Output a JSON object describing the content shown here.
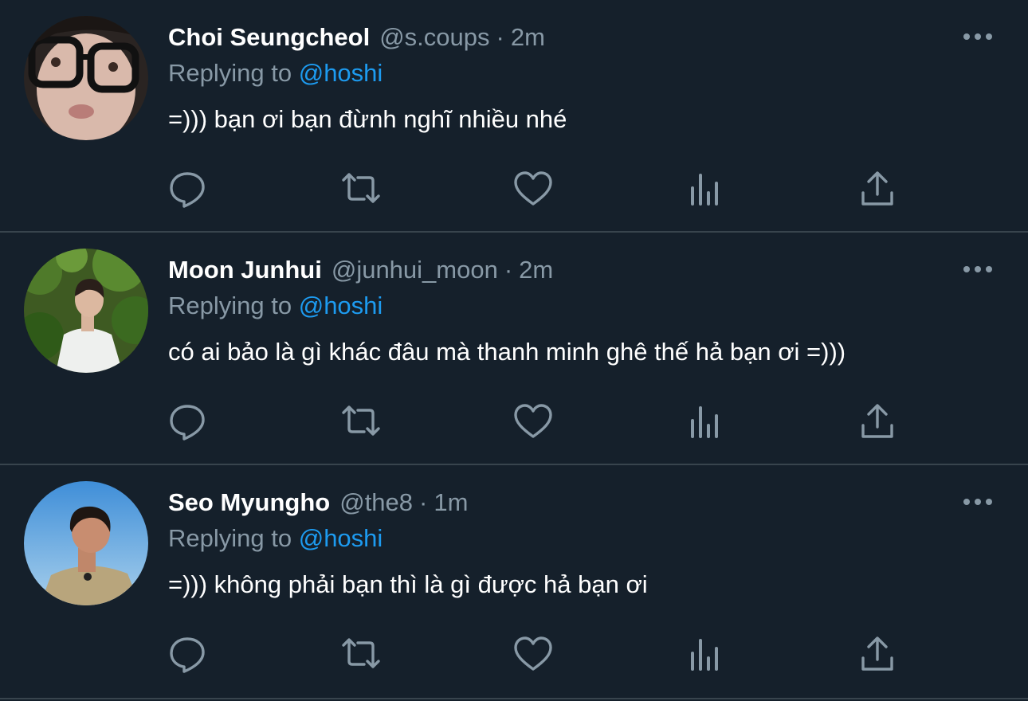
{
  "colors": {
    "background": "#15202b",
    "divider": "#38444d",
    "secondary_text": "#8899a6",
    "mention": "#1d9bf0",
    "icon": "#8899a6"
  },
  "icons": [
    "reply-icon",
    "retweet-icon",
    "like-icon",
    "analytics-icon",
    "share-icon",
    "more-options-icon"
  ],
  "tweets": [
    {
      "name": "Choi Seungcheol",
      "handle": "@s.coups",
      "separator": "·",
      "time": "2m",
      "replying_prefix": "Replying to",
      "replying_to": "@hoshi",
      "text": "=))) bạn ơi bạn đừnh nghĩ nhiều nhé"
    },
    {
      "name": "Moon Junhui",
      "handle": "@junhui_moon",
      "separator": "·",
      "time": "2m",
      "replying_prefix": "Replying to",
      "replying_to": "@hoshi",
      "text": "có ai bảo là gì khác đâu mà thanh minh ghê thế hả bạn ơi =)))"
    },
    {
      "name": "Seo Myungho",
      "handle": "@the8",
      "separator": "·",
      "time": "1m",
      "replying_prefix": "Replying to",
      "replying_to": "@hoshi",
      "text": "=))) không phải bạn thì là gì được hả bạn ơi"
    }
  ]
}
